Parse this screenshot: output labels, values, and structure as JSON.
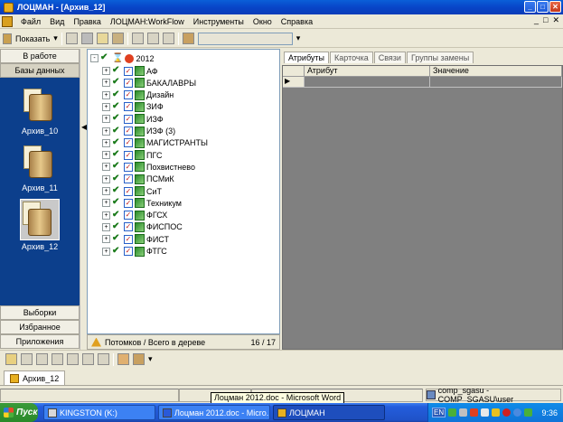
{
  "window": {
    "title": "ЛОЦМАН - [Архив_12]",
    "min": "_",
    "max": "□",
    "close": "✕",
    "mdi_min": "_",
    "mdi_max": "□",
    "mdi_close": "✕"
  },
  "menu": [
    "Файл",
    "Вид",
    "Правка",
    "ЛОЦМАН:WorkFlow",
    "Инструменты",
    "Окно",
    "Справка"
  ],
  "toolbar": {
    "show_label": "Показать",
    "dropdown_arrow": "▾"
  },
  "left": {
    "top_buttons": [
      "В работе",
      "Базы данных"
    ],
    "archives": [
      {
        "label": "Архив_10"
      },
      {
        "label": "Архив_11"
      },
      {
        "label": "Архив_12",
        "selected": true
      }
    ],
    "bottom_buttons": [
      "Выборки",
      "Избранное",
      "Приложения"
    ],
    "collapse": "◀"
  },
  "tree": {
    "root": "2012",
    "expand": "+",
    "collapse": "-",
    "items": [
      "АФ",
      "БАКАЛАВРЫ",
      "Дизайн",
      "ЗИФ",
      "ИЗФ",
      "ИЗФ (3)",
      "МАГИСТРАНТЫ",
      "ПГС",
      "Похвистнево",
      "ПСМиК",
      "СиТ",
      "Техникум",
      "ФГСХ",
      "ФИСПОС",
      "ФИСТ",
      "ФТГС"
    ],
    "status_label": "Потомков / Всего в дереве",
    "status_count": "16 / 17"
  },
  "right": {
    "tabs": [
      "Атрибуты",
      "Карточка",
      "Связи",
      "Группы замены"
    ],
    "columns": [
      "Атрибут",
      "Значение"
    ],
    "row_marker": "▶"
  },
  "doc_tab": "Архив_12",
  "tooltip": "Лоцман 2012.doc - Microsoft Word",
  "status_user": "comp_sgasu - COMP_SGASU\\user",
  "taskbar": {
    "start": "Пуск",
    "items": [
      "KINGSTON (K:)",
      "Лоцман 2012.doc - Micro...",
      "ЛОЦМАН"
    ],
    "lang": "EN",
    "clock": "9:36"
  },
  "colors": {
    "titlebar": "#0845c8",
    "left_strip": "#0c3f8c",
    "taskbar": "#245ddc",
    "start": "#2a8a2a"
  }
}
